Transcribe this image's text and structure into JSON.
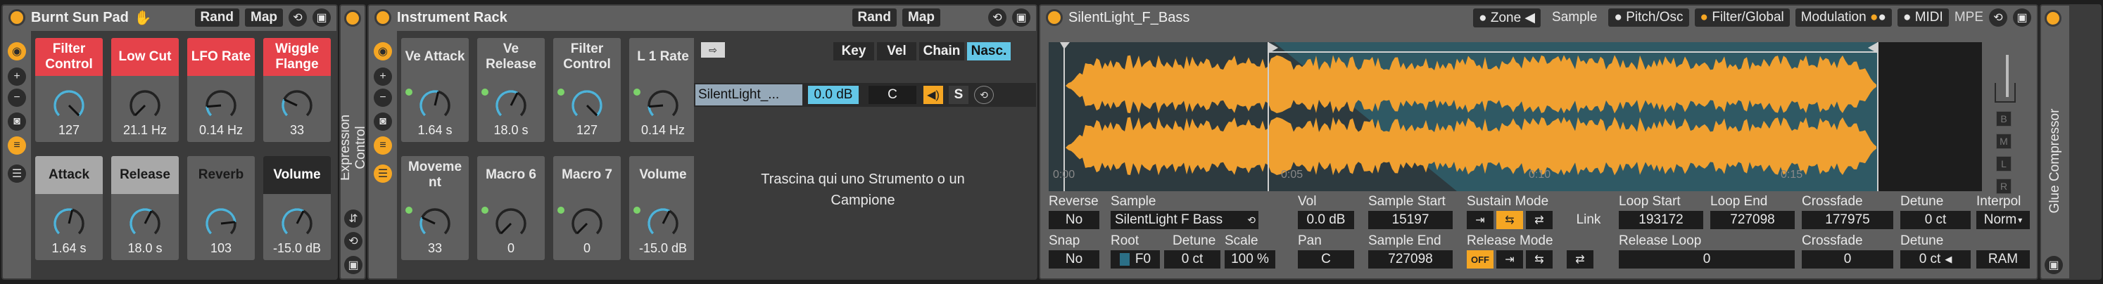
{
  "rack": {
    "title": "Burnt Sun Pad",
    "rand": "Rand",
    "map": "Map",
    "macros": [
      {
        "label": "Filter Control",
        "value": "127",
        "style": "red",
        "level": 1.0
      },
      {
        "label": "Low Cut",
        "value": "21.1 Hz",
        "style": "red",
        "level": 0.0
      },
      {
        "label": "LFO Rate",
        "value": "0.14 Hz",
        "style": "red",
        "level": 0.15
      },
      {
        "label": "Wiggle Flange",
        "value": "33",
        "style": "red",
        "level": 0.26
      },
      {
        "label": "Attack",
        "value": "1.64 s",
        "style": "gray",
        "level": 0.55
      },
      {
        "label": "Release",
        "value": "18.0 s",
        "style": "gray",
        "level": 0.6
      },
      {
        "label": "Reverb",
        "value": "103",
        "style": "dk",
        "level": 0.81
      },
      {
        "label": "Volume",
        "value": "-15.0 dB",
        "style": "blk",
        "level": 0.6
      }
    ]
  },
  "expression": {
    "label": "Expression Control"
  },
  "instrument_rack": {
    "title": "Instrument Rack",
    "rand": "Rand",
    "map": "Map",
    "macros": [
      {
        "label": "Ve Attack",
        "value": "1.64 s",
        "level": 0.55
      },
      {
        "label": "Ve Release",
        "value": "18.0 s",
        "level": 0.6
      },
      {
        "label": "Filter Control",
        "value": "127",
        "level": 1.0
      },
      {
        "label": "L 1 Rate",
        "value": "0.14 Hz",
        "level": 0.15
      },
      {
        "label": "Moveme nt",
        "value": "33",
        "level": 0.26
      },
      {
        "label": "Macro 6",
        "value": "0",
        "level": 0.0
      },
      {
        "label": "Macro 7",
        "value": "0",
        "level": 0.0
      },
      {
        "label": "Volume",
        "value": "-15.0 dB",
        "level": 0.6
      }
    ],
    "chain_tabs": {
      "key": "Key",
      "vel": "Vel",
      "chain": "Chain",
      "nasc": "Nasc."
    },
    "chain": {
      "name": "SilentLight_...",
      "volume": "0.0 dB",
      "pan": "C",
      "solo": "S"
    },
    "drop_hint": "Trascina qui uno Strumento o un Campione"
  },
  "sampler": {
    "title": "SilentLight_F_Bass",
    "tabs": {
      "zone": "Zone",
      "sample": "Sample",
      "pitch": "Pitch/Osc",
      "filter": "Filter/Global",
      "modulation": "Modulation",
      "midi": "MIDI",
      "mpe": "MPE"
    },
    "timeline": [
      "0:00",
      "0:05",
      "0:10",
      "0:15"
    ],
    "side_buttons": [
      "B",
      "M",
      "L",
      "R"
    ],
    "params": {
      "reverse_label": "Reverse",
      "reverse": "No",
      "snap_label": "Snap",
      "snap": "No",
      "sample_label": "Sample",
      "sample": "SilentLight F Bass",
      "root_label": "Root",
      "root": "F0",
      "detune_label": "Detune",
      "detune": "0 ct",
      "scale_label": "Scale",
      "scale": "100 %",
      "vol_label": "Vol",
      "vol": "0.0 dB",
      "pan_label": "Pan",
      "pan": "C",
      "sample_start_label": "Sample Start",
      "sample_start": "15197",
      "sample_end_label": "Sample End",
      "sample_end": "727098",
      "sustain_mode_label": "Sustain Mode",
      "release_mode_label": "Release Mode",
      "release_off": "OFF",
      "link": "Link",
      "loop_start_label": "Loop Start",
      "loop_start": "193172",
      "loop_end_label": "Loop End",
      "loop_end": "727098",
      "release_loop_label": "Release Loop",
      "release_loop": "0",
      "crossfade_label": "Crossfade",
      "crossfade": "177975",
      "crossfade2_label": "Crossfade",
      "crossfade2": "0",
      "detune2_label": "Detune",
      "detune2": "0 ct",
      "detune3_label": "Detune",
      "detune3": "0 ct",
      "interpol_label": "Interpol",
      "interpol": "Norm",
      "ram": "RAM"
    }
  },
  "glue": {
    "label": "Glue Compressor"
  },
  "colors": {
    "accent": "#f5a623",
    "red": "#e5424a",
    "knob_arc": "#4fb3d9",
    "waveform": "#f0a030"
  }
}
